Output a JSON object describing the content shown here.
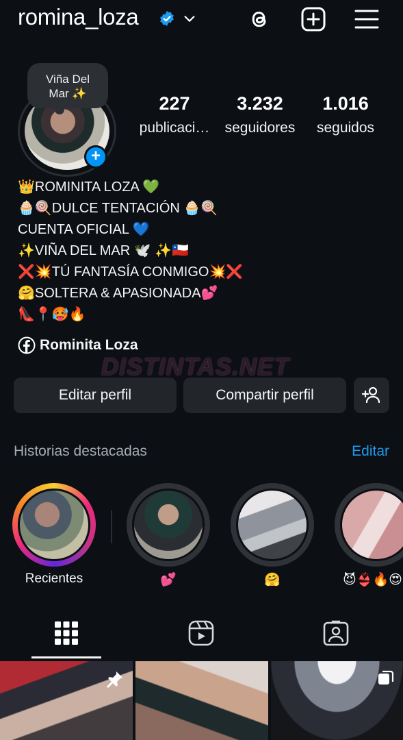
{
  "header": {
    "username": "romina_loza",
    "icons": [
      "verified-badge-icon",
      "chevron-down-icon",
      "threads-icon",
      "new-post-icon",
      "menu-icon"
    ]
  },
  "profile": {
    "note": "Viña Del Mar ✨",
    "stats": [
      {
        "value": "227",
        "label": "publicaci…"
      },
      {
        "value": "3.232",
        "label": "seguidores"
      },
      {
        "value": "1.016",
        "label": "seguidos"
      }
    ],
    "bio": [
      "👑ROMINITA LOZA 💚",
      "🧁🍭DULCE TENTACIÓN 🧁🍭",
      "CUENTA OFICIAL 💙",
      "✨VIÑA DEL MAR 🕊️ ✨🇨🇱",
      "❌💥TÚ FANTASÍA CONMIGO💥❌",
      "🤗SOLTERA & APASIONADA💕",
      "👠📍🥵🔥"
    ],
    "facebook_link": "Rominita Loza",
    "watermark": "DISTINTAS.NET"
  },
  "actions": {
    "edit_label": "Editar perfil",
    "share_label": "Compartir perfil"
  },
  "highlights": {
    "title": "Historias destacadas",
    "edit_label": "Editar",
    "items": [
      {
        "label": "Recientes"
      },
      {
        "label": "💕"
      },
      {
        "label": "🤗"
      },
      {
        "label": "😈👙🔥😍"
      }
    ]
  },
  "tabs": [
    "grid-icon",
    "reels-icon",
    "tagged-icon"
  ],
  "colors": {
    "background": "#0c0f14",
    "accent_blue": "#1d9bf0",
    "button_bg": "#22262b",
    "muted_text": "#a8adb5"
  }
}
